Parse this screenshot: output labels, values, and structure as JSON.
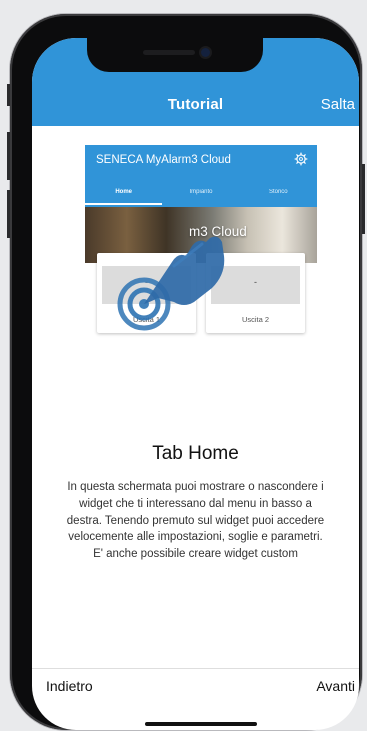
{
  "header": {
    "title": "Tutorial",
    "skip_label": "Salta"
  },
  "preview": {
    "app_title": "SENECA MyAlarm3 Cloud",
    "tabs": [
      "Home",
      "Impianto",
      "Storico"
    ],
    "banner_text": "m3 Cloud",
    "cards": [
      {
        "value": "-",
        "label": "Uscita 1"
      },
      {
        "value": "-",
        "label": "Uscita 2"
      }
    ]
  },
  "content": {
    "title": "Tab Home",
    "description": "In questa schermata puoi mostrare o nascondere i widget che ti interessano dal menu in basso a destra. Tenendo premuto sul widget puoi accedere velocemente alle impostazioni, soglie e parametri. E' anche possibile creare widget custom"
  },
  "footer": {
    "back_label": "Indietro",
    "next_label": "Avanti"
  },
  "colors": {
    "accent": "#3094d8",
    "background": "#ffffff"
  },
  "icons": {
    "settings": "gear-icon",
    "gesture": "tap-gesture-icon"
  }
}
